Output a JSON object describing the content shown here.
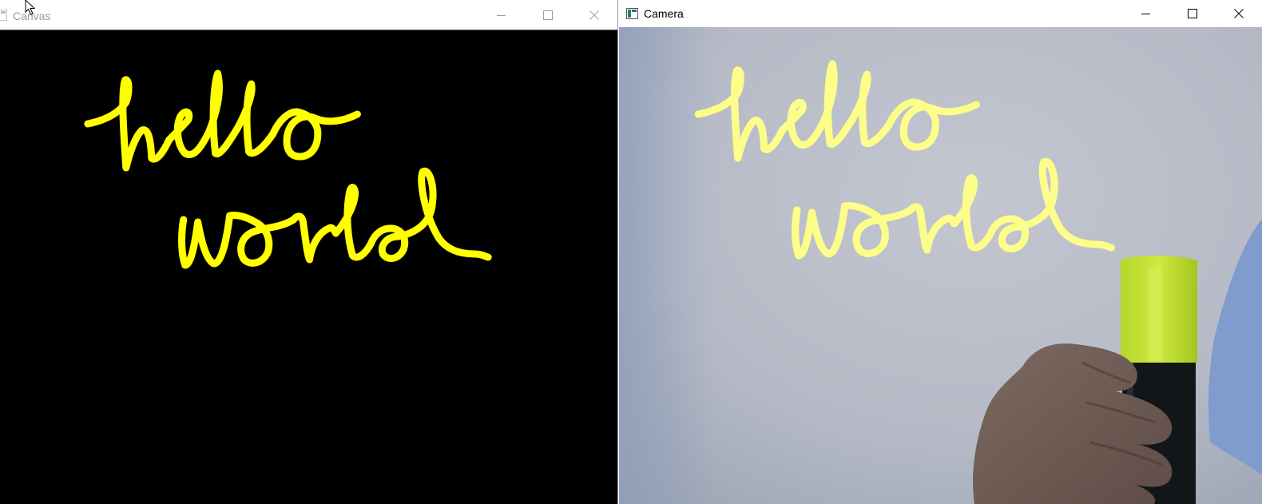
{
  "windows": {
    "canvas": {
      "title": "Canvas",
      "state": "inactive",
      "background": "#000000",
      "ink_color": "#ffff00",
      "drawing_icon": "handwritten-hello-world"
    },
    "camera": {
      "title": "Camera",
      "state": "active",
      "ink_color": "#fdfd8a",
      "scene": {
        "wall_color": "#b8bcc6",
        "marker_cap_color": "#c5e838",
        "marker_body_color": "#101418",
        "hand_icon": "hand-holding-marker"
      }
    }
  },
  "controls": {
    "minimize_icon": "minimize-icon",
    "maximize_icon": "maximize-icon",
    "close_icon": "close-icon"
  },
  "cursor_icon": "mouse-pointer-icon"
}
